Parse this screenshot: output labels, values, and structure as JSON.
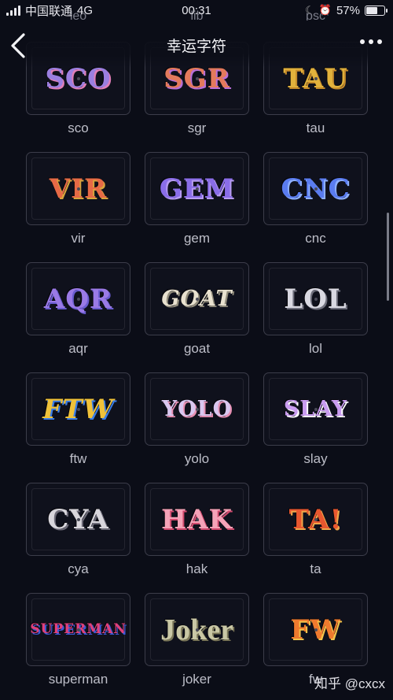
{
  "status_bar": {
    "carrier": "中国联通",
    "network": "4G",
    "time": "00:31",
    "battery": "57%"
  },
  "nav": {
    "title": "幸运字符",
    "back_icon": "chevron-left-icon",
    "more_icon": "more-dots-icon"
  },
  "top_partial_labels": [
    "leo",
    "lib",
    "psc"
  ],
  "items": [
    {
      "art": "SCO",
      "label": "sco",
      "color": "#9b7fe0",
      "accent": "#e07fb8"
    },
    {
      "art": "SGR",
      "label": "sgr",
      "color": "#e37a5c",
      "accent": "#b86fd8"
    },
    {
      "art": "TAU",
      "label": "tau",
      "color": "#e2b23c",
      "accent": "#c48a2a"
    },
    {
      "art": "VIR",
      "label": "vir",
      "color": "#e66a46",
      "accent": "#d8a43c"
    },
    {
      "art": "GEM",
      "label": "gem",
      "color": "#8a6de8",
      "accent": "#b79cf2"
    },
    {
      "art": "CNC",
      "label": "cnc",
      "color": "#5a7cf0",
      "accent": "#8eb0ff"
    },
    {
      "art": "AQR",
      "label": "aqr",
      "color": "#9a7ae6",
      "accent": "#6a5cd0"
    },
    {
      "art": "GOAT",
      "label": "goat",
      "color": "#e8e1cf",
      "accent": "#8f8a7a"
    },
    {
      "art": "LOL",
      "label": "lol",
      "color": "#d9d9e2",
      "accent": "#6e6f7c"
    },
    {
      "art": "FTW",
      "label": "ftw",
      "color": "#f0c23a",
      "accent": "#3a7de8"
    },
    {
      "art": "YOLO",
      "label": "yolo",
      "color": "#d9c7f0",
      "accent": "#e78fb2"
    },
    {
      "art": "SLAY",
      "label": "slay",
      "color": "#c99cf0",
      "accent": "#ffffff"
    },
    {
      "art": "CYA",
      "label": "cya",
      "color": "#d8d6dc",
      "accent": "#6d6b78"
    },
    {
      "art": "HAK",
      "label": "hak",
      "color": "#f5a3b8",
      "accent": "#d14a6e"
    },
    {
      "art": "TA!",
      "label": "ta",
      "color": "#e8572f",
      "accent": "#f0a64a"
    },
    {
      "art": "SUPERMAN",
      "label": "superman",
      "color": "#e0407a",
      "accent": "#3c5ad8"
    },
    {
      "art": "Joker",
      "label": "joker",
      "color": "#c9c7a5",
      "accent": "#7a7658"
    },
    {
      "art": "FW",
      "label": "fw",
      "color": "#ef7a2e",
      "accent": "#f5c34a"
    }
  ],
  "watermark": "知乎 @cxcx"
}
